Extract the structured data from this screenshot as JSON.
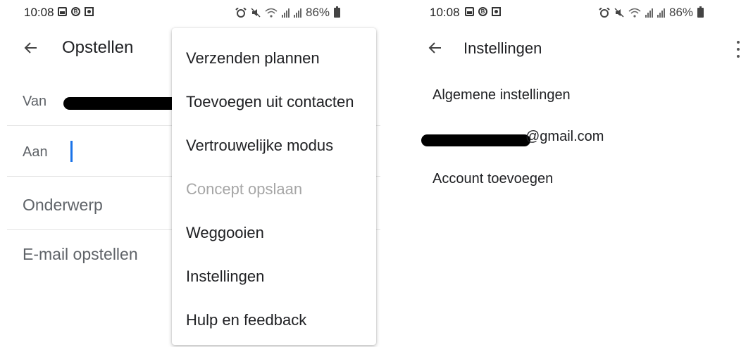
{
  "left_screen": {
    "status_bar": {
      "time": "10:08",
      "battery": "86%"
    },
    "app_bar": {
      "title": "Opstellen"
    },
    "compose": {
      "from_label": "Van",
      "to_label": "Aan",
      "subject_placeholder": "Onderwerp",
      "body_placeholder": "E-mail opstellen"
    },
    "overflow_menu": {
      "items": [
        {
          "label": "Verzenden plannen"
        },
        {
          "label": "Toevoegen uit contacten"
        },
        {
          "label": "Vertrouwelijke modus"
        },
        {
          "label": "Concept opslaan",
          "disabled": true
        },
        {
          "label": "Weggooien"
        },
        {
          "label": "Instellingen"
        },
        {
          "label": "Hulp en feedback"
        }
      ]
    }
  },
  "right_screen": {
    "status_bar": {
      "time": "10:08",
      "battery": "86%"
    },
    "app_bar": {
      "title": "Instellingen"
    },
    "settings": {
      "general": "Algemene instellingen",
      "account_email_suffix": "@gmail.com",
      "add_account": "Account toevoegen"
    }
  },
  "colors": {
    "cursor": "#1a73e8",
    "disabled_text": "#a6a6a6",
    "redaction": "#000000"
  },
  "icons": [
    "picture-icon",
    "b-circle-icon",
    "square-icon",
    "alarm-icon",
    "mute-icon",
    "wifi-icon",
    "signal-icon",
    "battery-icon",
    "back-arrow-icon",
    "more-vert-icon"
  ]
}
